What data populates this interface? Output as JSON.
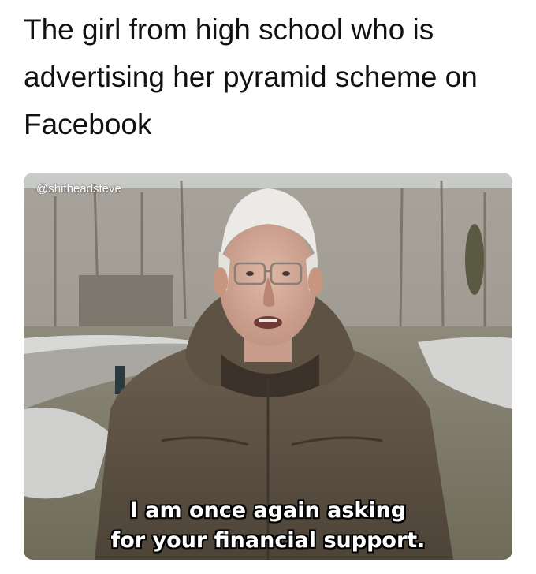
{
  "caption": {
    "line1": "The girl from high school who is",
    "line2": "advertising her pyramid scheme on",
    "line3": "Facebook"
  },
  "photo": {
    "watermark": "@shitheadsteve",
    "subtitle_line1": "I am once again asking",
    "subtitle_line2": "for your financial support."
  }
}
